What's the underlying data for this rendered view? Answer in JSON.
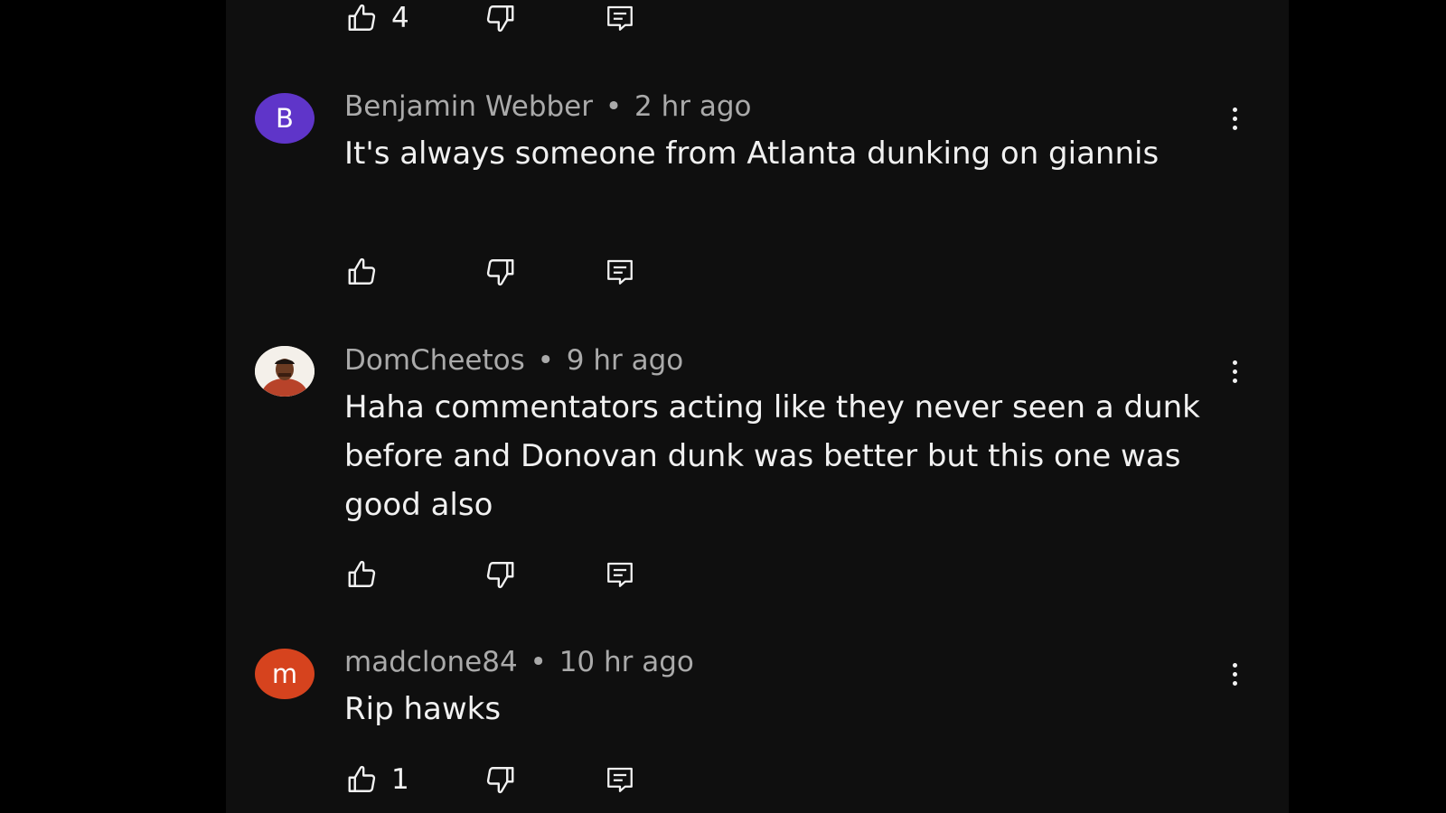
{
  "colors": {
    "page_bg": "#000000",
    "panel_bg": "#0f0f0f",
    "text_primary": "#f1f1f1",
    "text_secondary": "#aaaaaa",
    "avatar_b": "#5f35c9",
    "avatar_m": "#d6431e"
  },
  "top_actions": {
    "like_count": "4"
  },
  "comments": [
    {
      "avatar_letter": "B",
      "author": "Benjamin Webber",
      "separator": "•",
      "time": "2 hr ago",
      "text": "It's always someone from Atlanta dunking on giannis",
      "like_count": ""
    },
    {
      "avatar_letter": "",
      "author": "DomCheetos",
      "separator": "•",
      "time": "9 hr ago",
      "text": "Haha commentators acting like they never seen a dunk before and Donovan dunk was better but this one was good also",
      "like_count": ""
    },
    {
      "avatar_letter": "m",
      "author": "madclone84",
      "separator": "•",
      "time": "10 hr ago",
      "text": "Rip hawks",
      "like_count": "1"
    }
  ],
  "icons": {
    "like": "thumbs-up-icon",
    "dislike": "thumbs-down-icon",
    "reply": "reply-comment-icon",
    "more": "more-vertical-icon"
  }
}
